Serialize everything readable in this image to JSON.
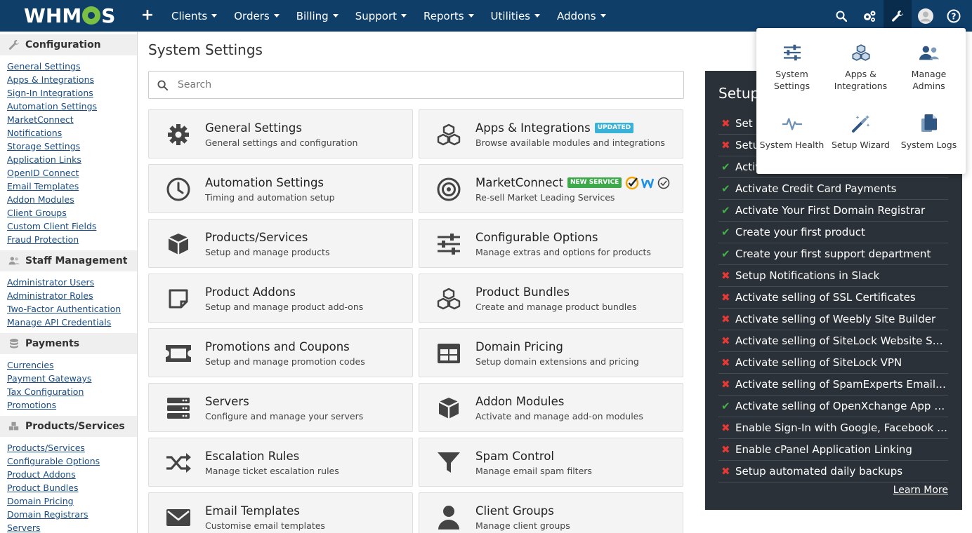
{
  "app": {
    "logo": "WHMCS",
    "colors": {
      "navbar": "#0f3e69",
      "accent_green": "#7bc043",
      "setup_bg": "#2b3138",
      "link": "#1a4c85"
    }
  },
  "navbar": {
    "plus_icon": "plus-icon",
    "menu": [
      {
        "label": "Clients"
      },
      {
        "label": "Orders"
      },
      {
        "label": "Billing"
      },
      {
        "label": "Support"
      },
      {
        "label": "Reports"
      },
      {
        "label": "Utilities"
      },
      {
        "label": "Addons"
      }
    ],
    "right_icons": [
      "search-icon",
      "cogs-icon",
      "wrench-icon",
      "avatar-icon",
      "help-icon"
    ]
  },
  "sidebar": {
    "sections": [
      {
        "title": "Configuration",
        "icon": "wrench-icon",
        "links": [
          "General Settings",
          "Apps & Integrations",
          "Sign-In Integrations",
          "Automation Settings",
          "MarketConnect",
          "Notifications",
          "Storage Settings",
          "Application Links",
          "OpenID Connect",
          "Email Templates",
          "Addon Modules",
          "Client Groups",
          "Custom Client Fields",
          "Fraud Protection"
        ]
      },
      {
        "title": "Staff Management",
        "icon": "users-icon",
        "links": [
          "Administrator Users",
          "Administrator Roles",
          "Two-Factor Authentication",
          "Manage API Credentials"
        ]
      },
      {
        "title": "Payments",
        "icon": "coins-icon",
        "links": [
          "Currencies",
          "Payment Gateways",
          "Tax Configuration",
          "Promotions"
        ]
      },
      {
        "title": "Products/Services",
        "icon": "cubes-icon",
        "links": [
          "Products/Services",
          "Configurable Options",
          "Product Addons",
          "Product Bundles",
          "Domain Pricing",
          "Domain Registrars",
          "Servers"
        ]
      }
    ]
  },
  "main": {
    "title": "System Settings",
    "search_placeholder": "Search",
    "cards": [
      {
        "title": "General Settings",
        "desc": "General settings and configuration",
        "icon": "gear-icon",
        "badge": ""
      },
      {
        "title": "Apps & Integrations",
        "desc": "Browse available modules and integrations",
        "icon": "cubes-icon",
        "badge": "UPDATED"
      },
      {
        "title": "Automation Settings",
        "desc": "Timing and automation setup",
        "icon": "clock-icon",
        "badge": ""
      },
      {
        "title": "MarketConnect",
        "desc": "Re-sell Market Leading Services",
        "icon": "target-icon",
        "badge": "NEW SERVICE"
      },
      {
        "title": "Products/Services",
        "desc": "Setup and manage products",
        "icon": "box-icon",
        "badge": ""
      },
      {
        "title": "Configurable Options",
        "desc": "Manage extras and options for products",
        "icon": "sliders-icon",
        "badge": ""
      },
      {
        "title": "Product Addons",
        "desc": "Setup and manage product add-ons",
        "icon": "sticky-note-icon",
        "badge": ""
      },
      {
        "title": "Product Bundles",
        "desc": "Create and manage product bundles",
        "icon": "cubes-icon",
        "badge": ""
      },
      {
        "title": "Promotions and Coupons",
        "desc": "Setup and manage promotion codes",
        "icon": "ticket-icon",
        "badge": ""
      },
      {
        "title": "Domain Pricing",
        "desc": "Setup domain extensions and pricing",
        "icon": "table-icon",
        "badge": ""
      },
      {
        "title": "Servers",
        "desc": "Configure and manage your servers",
        "icon": "server-icon",
        "badge": ""
      },
      {
        "title": "Addon Modules",
        "desc": "Activate and manage add-on modules",
        "icon": "cube-icon",
        "badge": ""
      },
      {
        "title": "Escalation Rules",
        "desc": "Manage ticket escalation rules",
        "icon": "random-icon",
        "badge": ""
      },
      {
        "title": "Spam Control",
        "desc": "Manage email spam filters",
        "icon": "filter-icon",
        "badge": ""
      },
      {
        "title": "Email Templates",
        "desc": "Customise email templates",
        "icon": "envelope-icon",
        "badge": ""
      },
      {
        "title": "Client Groups",
        "desc": "Manage client groups",
        "icon": "user-icon",
        "badge": ""
      }
    ]
  },
  "setup": {
    "title": "Setup",
    "items": [
      {
        "text": "Set Company Name and Logo",
        "done": false
      },
      {
        "text": "Setup Email Sending",
        "done": false
      },
      {
        "text": "Activate Payment Gateway",
        "done": true
      },
      {
        "text": "Activate Credit Card Payments",
        "done": true
      },
      {
        "text": "Activate Your First Domain Registrar",
        "done": true
      },
      {
        "text": "Create your first product",
        "done": true
      },
      {
        "text": "Create your first support department",
        "done": true
      },
      {
        "text": "Setup Notifications in Slack",
        "done": false
      },
      {
        "text": "Activate selling of SSL Certificates",
        "done": false
      },
      {
        "text": "Activate selling of Weebly Site Builder",
        "done": false
      },
      {
        "text": "Activate selling of SiteLock Website Security",
        "done": false
      },
      {
        "text": "Activate selling of SiteLock VPN",
        "done": false
      },
      {
        "text": "Activate selling of SpamExperts Email Security",
        "done": false
      },
      {
        "text": "Activate selling of OpenXchange App Suite",
        "done": true
      },
      {
        "text": "Enable Sign-In with Google, Facebook and Twitter",
        "done": false
      },
      {
        "text": "Enable cPanel Application Linking",
        "done": false
      },
      {
        "text": "Setup automated daily backups",
        "done": false
      }
    ],
    "learn_more": "Learn More"
  },
  "dropdown": {
    "items": [
      {
        "label": "System Settings",
        "icon": "sliders-icon"
      },
      {
        "label": "Apps & Integrations",
        "icon": "cubes-icon"
      },
      {
        "label": "Manage Admins",
        "icon": "users-icon"
      },
      {
        "label": "System Health",
        "icon": "heartbeat-icon"
      },
      {
        "label": "Setup Wizard",
        "icon": "magic-wand-icon"
      },
      {
        "label": "System Logs",
        "icon": "copy-icon"
      }
    ]
  }
}
